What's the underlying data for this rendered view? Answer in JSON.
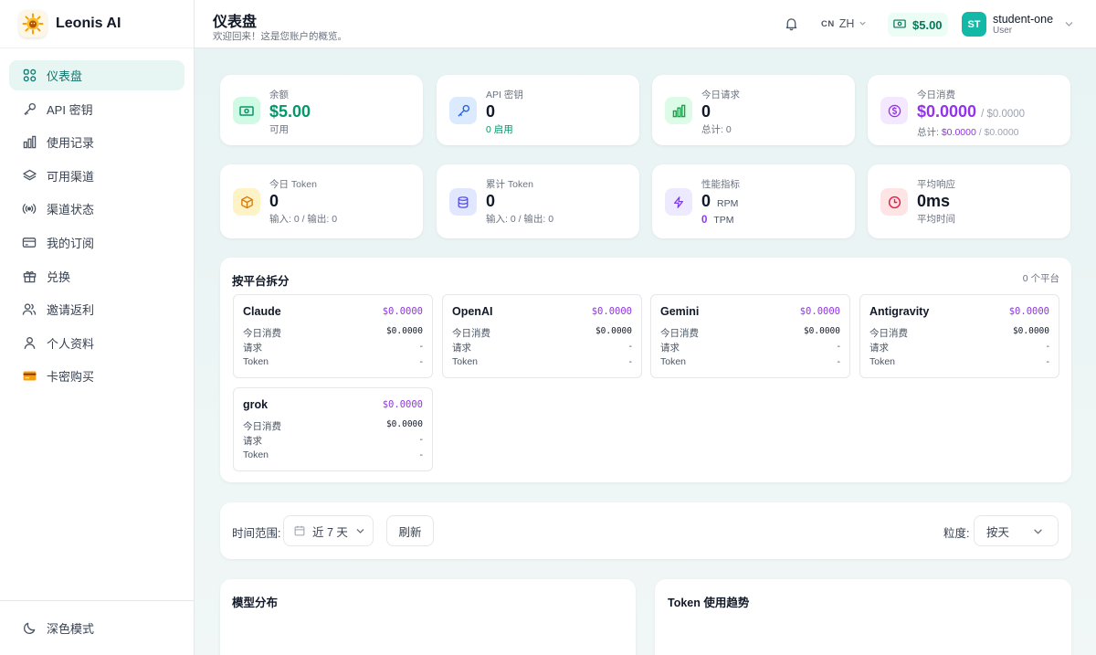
{
  "app": {
    "name": "Leonis AI",
    "logo_icon": "sun-lion-logo"
  },
  "sidebar": {
    "items": [
      {
        "label": "仪表盘",
        "icon": "dashboard-grid-icon",
        "active": true
      },
      {
        "label": "API 密钥",
        "icon": "key-icon"
      },
      {
        "label": "使用记录",
        "icon": "bar-chart-icon"
      },
      {
        "label": "可用渠道",
        "icon": "layers-icon"
      },
      {
        "label": "渠道状态",
        "icon": "signal-icon"
      },
      {
        "label": "我的订阅",
        "icon": "credit-card-icon"
      },
      {
        "label": "兑换",
        "icon": "gift-icon"
      },
      {
        "label": "邀请返利",
        "icon": "users-icon"
      },
      {
        "label": "个人资料",
        "icon": "user-icon"
      },
      {
        "label": "卡密购买",
        "icon": "card-emoji-icon"
      }
    ],
    "dark_mode_label": "深色模式"
  },
  "header": {
    "title": "仪表盘",
    "subtitle": "欢迎回来！这是您账户的概览。",
    "lang_flag": "CN",
    "lang": "ZH",
    "balance": "$5.00",
    "user_name": "student-one",
    "user_role": "User",
    "user_initials": "ST"
  },
  "stats": {
    "balance": {
      "label": "余额",
      "value": "$5.00",
      "sub": "可用"
    },
    "api_keys": {
      "label": "API 密钥",
      "value": "0",
      "sub": "0 启用"
    },
    "today_requests": {
      "label": "今日请求",
      "value": "0",
      "sub": "总计: 0"
    },
    "today_cost": {
      "label": "今日消费",
      "value": "$0.0000",
      "value_suffix": "/ $0.0000",
      "sub_prefix": "总计: ",
      "sub_value": "$0.0000",
      "sub_suffix": " / $0.0000"
    },
    "today_tokens": {
      "label": "今日 Token",
      "value": "0",
      "sub": "输入: 0 / 输出: 0"
    },
    "total_tokens": {
      "label": "累计 Token",
      "value": "0",
      "sub": "输入: 0 / 输出: 0"
    },
    "performance": {
      "label": "性能指标",
      "value": "0",
      "unit": "RPM",
      "sub_value": "0",
      "sub_unit": "TPM"
    },
    "avg_response": {
      "label": "平均响应",
      "value": "0ms",
      "sub": "平均时间"
    }
  },
  "platforms": {
    "title": "按平台拆分",
    "count": "0 个平台",
    "row_labels": {
      "cost": "今日消费",
      "requests": "请求",
      "tokens": "Token"
    },
    "items": [
      {
        "name": "Claude",
        "cost": "$0.0000",
        "today_cost": "$0.0000",
        "requests": "-",
        "tokens": "-"
      },
      {
        "name": "OpenAI",
        "cost": "$0.0000",
        "today_cost": "$0.0000",
        "requests": "-",
        "tokens": "-"
      },
      {
        "name": "Gemini",
        "cost": "$0.0000",
        "today_cost": "$0.0000",
        "requests": "-",
        "tokens": "-"
      },
      {
        "name": "Antigravity",
        "cost": "$0.0000",
        "today_cost": "$0.0000",
        "requests": "-",
        "tokens": "-"
      },
      {
        "name": "grok",
        "cost": "$0.0000",
        "today_cost": "$0.0000",
        "requests": "-",
        "tokens": "-"
      }
    ]
  },
  "filters": {
    "range_label": "时间范围:",
    "range_value": "近 7 天",
    "refresh_label": "刷新",
    "granularity_label": "粒度:",
    "granularity_value": "按天"
  },
  "charts": {
    "model_dist_title": "模型分布",
    "token_trend_title": "Token 使用趋势"
  },
  "colors": {
    "accent": "#0f766e",
    "money": "#059669",
    "cost": "#9333ea"
  }
}
